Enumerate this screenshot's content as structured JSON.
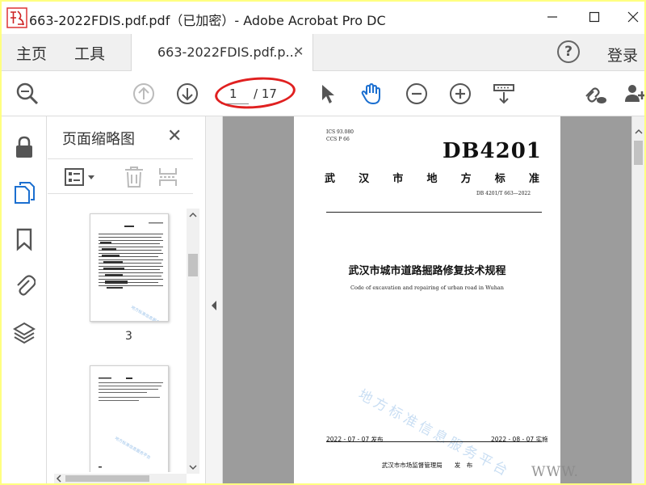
{
  "window": {
    "title": "663-2022FDIS.pdf.pdf（已加密）- Adobe Acrobat Pro DC",
    "logo_text": "道标网"
  },
  "tabbar": {
    "home_label": "主页",
    "tools_label": "工具",
    "doc_tab_label": "663-2022FDIS.pdf.p...",
    "signin_label": "登录"
  },
  "toolbar": {
    "current_page": "1",
    "total_pages": "/ 17",
    "annotation_color": "#e02020"
  },
  "thumbnails": {
    "title": "页面缩略图",
    "pages": [
      {
        "label": "3"
      },
      {
        "label": ""
      }
    ]
  },
  "document": {
    "ics": "ICS 93.080",
    "ccs": "CCS P 66",
    "logo": "DB4201",
    "standard_chars": [
      "武",
      "汉",
      "市",
      "地",
      "方",
      "标",
      "准"
    ],
    "std_number": "DB 4201/T 663—2022",
    "title_cn": "武汉市城市道路掘路修复技术规程",
    "title_en": "Code of excavation and repairing of urban road in Wuhan",
    "watermark": "地方标准信息服务平台",
    "release_date": "2022 - 07 - 07 发布",
    "impl_date": "2022 - 08 - 07 实施",
    "issuer": "武汉市市场监督管理局　　发　布"
  },
  "corner_watermark": "WWW."
}
